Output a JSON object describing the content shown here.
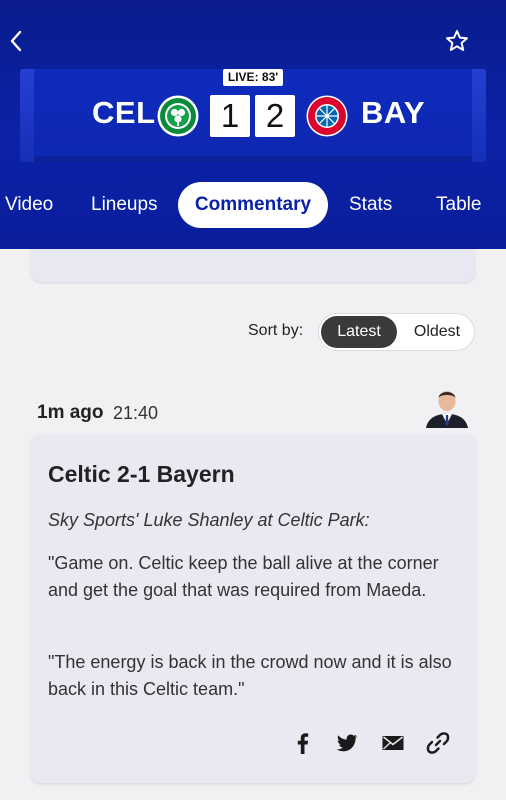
{
  "header": {
    "live": "LIVE: 83'",
    "home": {
      "abbr": "CEL",
      "score": "1"
    },
    "away": {
      "abbr": "BAY",
      "score": "2"
    },
    "tabs": [
      "Video",
      "Lineups",
      "Commentary",
      "Stats",
      "Table"
    ],
    "active_tab": "Commentary"
  },
  "sort": {
    "label": "Sort by:",
    "options": [
      "Latest",
      "Oldest"
    ],
    "selected": "Latest"
  },
  "entry": {
    "time_ago": "1m ago",
    "time": "21:40",
    "title": "Celtic 2-1 Bayern",
    "byline": "Sky Sports' Luke Shanley at Celtic Park:",
    "paragraphs": [
      "\"Game on. Celtic keep the ball alive at the corner and get the goal that was required from Maeda.",
      "\"The energy is back in the crowd now and it is also back in this Celtic team.\""
    ]
  },
  "icons": [
    "chevron-left-icon",
    "star-icon",
    "celtic-crest-icon",
    "bayern-crest-icon",
    "facebook-icon",
    "twitter-icon",
    "email-icon",
    "link-icon"
  ],
  "colors": {
    "header_blue": "#0b22a8",
    "active_tab_text": "#0b22a8",
    "card_bg": "#e9e9f2"
  }
}
